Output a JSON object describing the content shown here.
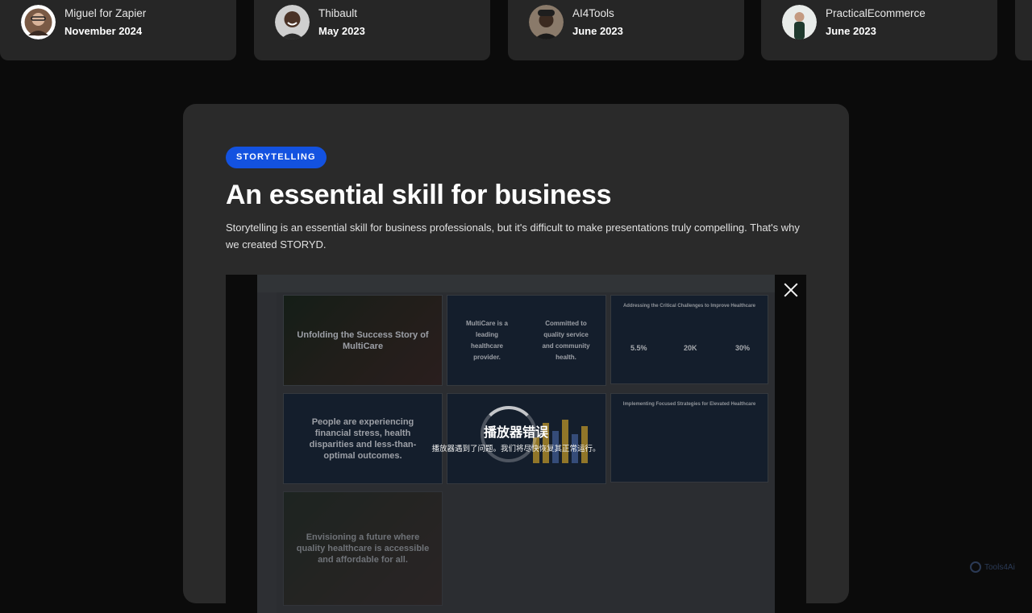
{
  "reviews": [
    {
      "name": "Miguel for Zapier",
      "date": "November 2024"
    },
    {
      "name": "Thibault",
      "date": "May 2023"
    },
    {
      "name": "AI4Tools",
      "date": "June 2023"
    },
    {
      "name": "PracticalEcommerce",
      "date": "June 2023"
    }
  ],
  "feature": {
    "badge": "STORYTELLING",
    "title": "An essential skill for business",
    "description": "Storytelling is an essential skill for business professionals, but it's difficult to make presentations truly compelling. That's why we created STORYD."
  },
  "player": {
    "error_title": "播放器错误",
    "error_message": "播放器遇到了问题。我们将尽快恢复其正常运行。",
    "slides": [
      "Unfolding the Success Story of MultiCare",
      "MultiCare is a leading healthcare provider.",
      "Committed to quality service and community health.",
      "Addressing the Critical Challenges to Improve Healthcare",
      "5.5%",
      "20K",
      "30%",
      "People are experiencing financial stress, health disparities and less-than-optimal outcomes.",
      "Implementing Focused Strategies for Elevated Healthcare",
      "Envisioning a future where quality healthcare is accessible and affordable for all."
    ]
  },
  "watermark": "Tools4Ai"
}
